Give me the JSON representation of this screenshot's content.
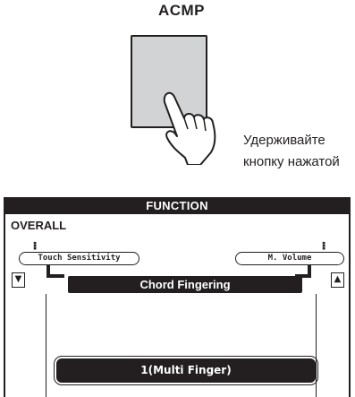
{
  "acmp": {
    "label": "ACMP"
  },
  "instruction": {
    "line1": "Удерживайте",
    "line2": "кнопку нажатой"
  },
  "lcd": {
    "title": "FUNCTION",
    "section": "OVERALL",
    "left_param": "Touch Sensitivity",
    "right_param": "M. Volume",
    "scroll_down_glyph": "▼",
    "scroll_up_glyph": "▲",
    "param_title": "Chord Fingering",
    "value": "1(Multi Finger)"
  }
}
